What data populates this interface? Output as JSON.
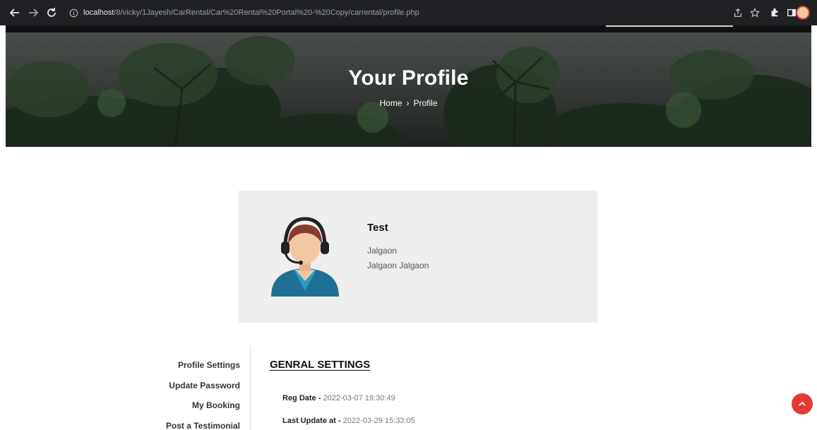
{
  "browser": {
    "url_host": "localhost",
    "url_path": "/8/vicky/1Jayesh/CarRental/Car%20Rental%20Portal%20-%20Copy/carrental/profile.php",
    "icons": [
      "back-arrow-icon",
      "forward-arrow-icon",
      "reload-icon",
      "info-icon",
      "share-icon",
      "star-icon",
      "puzzle-icon",
      "sidepanel-icon",
      "profile-avatar-icon"
    ]
  },
  "hero": {
    "title": "Your Profile",
    "breadcrumb": {
      "home": "Home",
      "separator": "›",
      "current": "Profile"
    }
  },
  "profile": {
    "name": "Test",
    "line1": "Jalgaon",
    "line2": "Jalgaon Jalgaon",
    "avatar_icon": "support-agent-avatar-icon"
  },
  "menu": {
    "items": [
      {
        "label": "Profile Settings"
      },
      {
        "label": "Update Password"
      },
      {
        "label": "My Booking"
      },
      {
        "label": "Post a Testimonial"
      }
    ]
  },
  "settings": {
    "title": "GENRAL SETTINGS",
    "reg_label": "Reg Date - ",
    "reg_value": "2022-03-07 19:30:49",
    "update_label": "Last Update at - ",
    "update_value": "2022-03-29 15:33:05"
  },
  "colors": {
    "scroll_top": "#e53935",
    "card_bg": "#eeeeee"
  }
}
